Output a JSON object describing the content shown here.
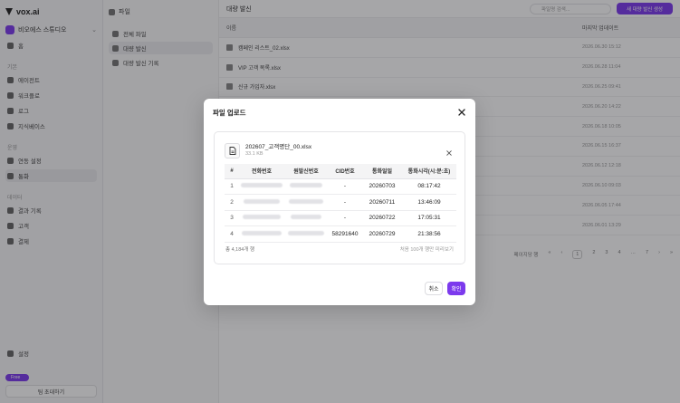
{
  "sidebar": {
    "brand": "vox.ai",
    "workspace": "비오에스 스튜디오",
    "items": [
      "홈",
      "에이전트",
      "워크플로",
      "로그",
      "지식베이스",
      "연동 설정",
      "통화",
      "결과 기록",
      "고객",
      "결제"
    ],
    "sections": [
      "기본",
      "운영",
      "데이터"
    ],
    "bottom_settings": "설정",
    "plan_badge": "Free",
    "team_button": "팀 초대하기"
  },
  "subnav": {
    "title": "파일",
    "items": [
      "전체 파일",
      "대량 발신",
      "대량 발신 기록"
    ]
  },
  "main": {
    "title": "대량 발신",
    "search_placeholder": "파일명 검색...",
    "new_button": "새 대량 발신 생성",
    "column_name": "이름",
    "column_date": "마지막 업데이트",
    "rows": [
      {
        "name": "캠페인 리스트_02.xlsx",
        "date": "2026.06.30 15:12"
      },
      {
        "name": "VIP 고객 목록.xlsx",
        "date": "2026.06.28 11:04"
      },
      {
        "name": "신규 가입자.xlsx",
        "date": "2026.06.25 09:41"
      },
      {
        "name": "",
        "date": "2026.06.20 14:22"
      },
      {
        "name": "",
        "date": "2026.06.18 10:05"
      },
      {
        "name": "",
        "date": "2026.06.15 16:37"
      },
      {
        "name": "",
        "date": "2026.06.12 12:18"
      },
      {
        "name": "",
        "date": "2026.06.10 09:03"
      },
      {
        "name": "",
        "date": "2026.06.05 17:44"
      },
      {
        "name": "",
        "date": "2026.06.01 13:29"
      }
    ],
    "pager_label": "페이지당 행",
    "pages": [
      "«",
      "‹",
      "1",
      "2",
      "3",
      "4",
      "…",
      "7",
      "›",
      "»"
    ]
  },
  "modal": {
    "title": "파일 업로드",
    "file": {
      "name": "202607_고객명단_00.xlsx",
      "size": "33.1 KB"
    },
    "columns": [
      "#",
      "전화번호",
      "원발신번호",
      "CID번호",
      "통화일일",
      "통화시각(시:분:초)"
    ],
    "rows": [
      {
        "idx": "1",
        "cid": "-",
        "date": "20260703",
        "time": "08:17:42"
      },
      {
        "idx": "2",
        "cid": "-",
        "date": "20260711",
        "time": "13:46:09"
      },
      {
        "idx": "3",
        "cid": "-",
        "date": "20260722",
        "time": "17:05:31"
      },
      {
        "idx": "4",
        "cid": "58291640",
        "date": "20260729",
        "time": "21:38:56"
      }
    ],
    "total": "총 4,184개 행",
    "preview_note": "처음 100개 행만 미리보기",
    "cancel": "취소",
    "confirm": "확인"
  },
  "colors": {
    "accent": "#7c3aed",
    "overlay": "rgba(20,20,25,0.38)"
  }
}
